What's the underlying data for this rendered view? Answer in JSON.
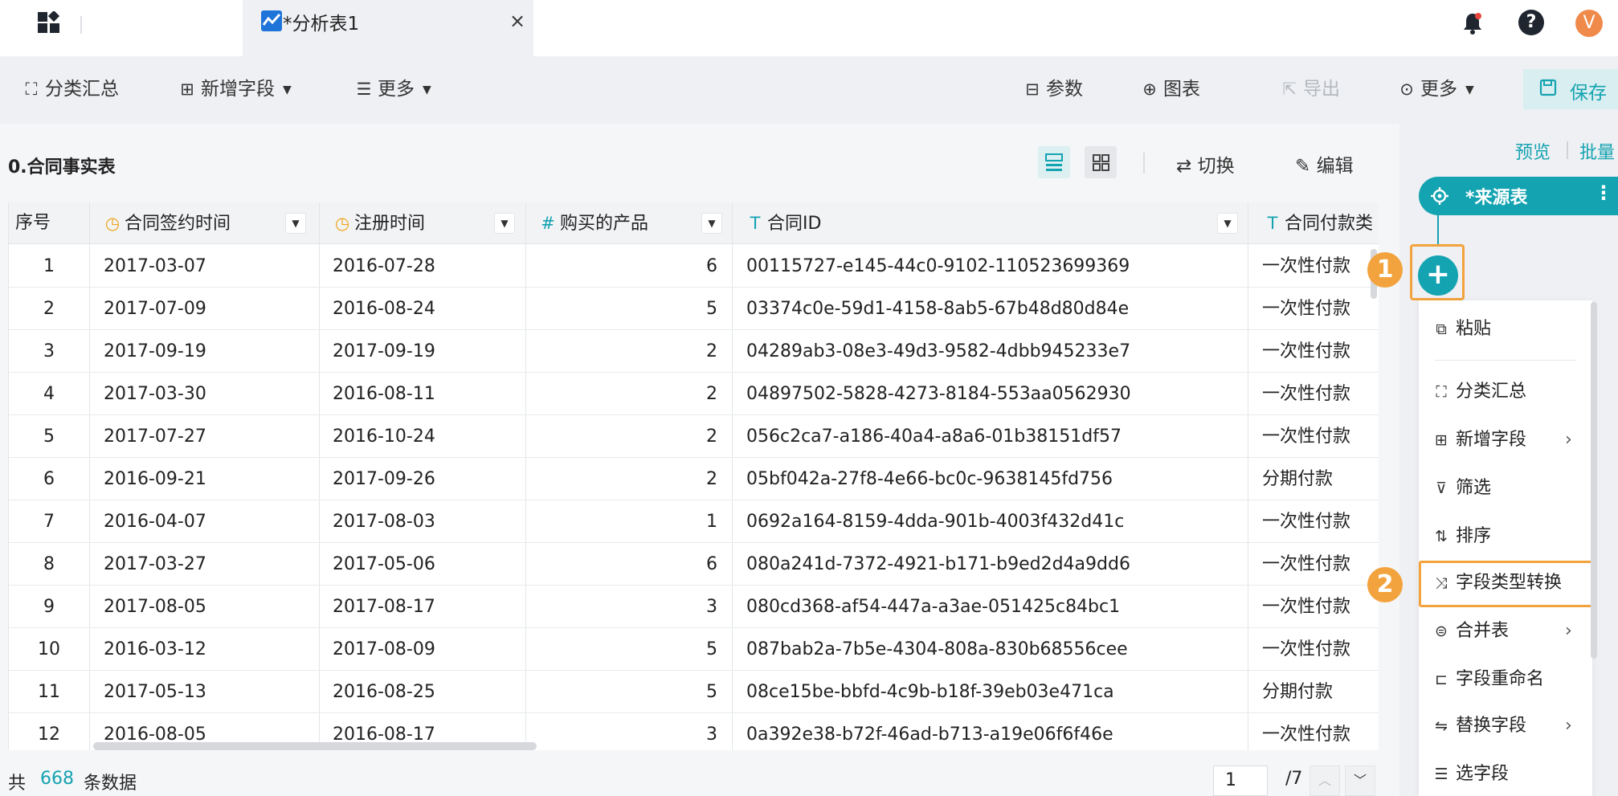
{
  "tab": {
    "title": "*分析表1",
    "close": "×"
  },
  "user": {
    "avatar_letter": "V",
    "help": "?"
  },
  "toolbar": {
    "group_summary": "分类汇总",
    "add_field": "新增字段",
    "more_left": "更多",
    "params": "参数",
    "chart": "图表",
    "export": "导出",
    "more_right": "更多",
    "save": "保存"
  },
  "table_title": "0.合同事实表",
  "table_actions": {
    "switch": "切换",
    "edit": "编辑"
  },
  "columns": [
    "序号",
    "合同签约时间",
    "注册时间",
    "购买的产品",
    "合同ID",
    "合同付款类"
  ],
  "rows": [
    [
      "1",
      "2017-03-07",
      "2016-07-28",
      "6",
      "00115727-e145-44c0-9102-110523699369",
      "一次性付款"
    ],
    [
      "2",
      "2017-07-09",
      "2016-08-24",
      "5",
      "03374c0e-59d1-4158-8ab5-67b48d80d84e",
      "一次性付款"
    ],
    [
      "3",
      "2017-09-19",
      "2017-09-19",
      "2",
      "04289ab3-08e3-49d3-9582-4dbb945233e7",
      "一次性付款"
    ],
    [
      "4",
      "2017-03-30",
      "2016-08-11",
      "2",
      "04897502-5828-4273-8184-553aa0562930",
      "一次性付款"
    ],
    [
      "5",
      "2017-07-27",
      "2016-10-24",
      "2",
      "056c2ca7-a186-40a4-a8a6-01b38151df57",
      "一次性付款"
    ],
    [
      "6",
      "2016-09-21",
      "2017-09-26",
      "2",
      "05bf042a-27f8-4e66-bc0c-9638145fd756",
      "分期付款"
    ],
    [
      "7",
      "2016-04-07",
      "2017-08-03",
      "1",
      "0692a164-8159-4dda-901b-4003f432d41c",
      "一次性付款"
    ],
    [
      "8",
      "2017-03-27",
      "2017-05-06",
      "6",
      "080a241d-7372-4921-b171-b9ed2d4a9dd6",
      "一次性付款"
    ],
    [
      "9",
      "2017-08-05",
      "2017-08-17",
      "3",
      "080cd368-af54-447a-a3ae-051425c84bc1",
      "一次性付款"
    ],
    [
      "10",
      "2016-03-12",
      "2017-08-09",
      "5",
      "087bab2a-7b5e-4304-808a-830b68556cee",
      "一次性付款"
    ],
    [
      "11",
      "2017-05-13",
      "2016-08-25",
      "5",
      "08ce15be-bbfd-4c9b-b18f-39eb03e471ca",
      "分期付款"
    ],
    [
      "12",
      "2016-08-05",
      "2016-08-17",
      "3",
      "0a392e38-b72f-46ad-b713-a19e06f6f46e",
      "一次性付款"
    ]
  ],
  "footer": {
    "prefix": "共",
    "count": "668",
    "suffix": "条数据",
    "page": "1",
    "total_pages": "/7"
  },
  "right_panel": {
    "preview": "预览",
    "batch": "批量",
    "node_title": "*来源表",
    "badge1": "1",
    "badge2": "2",
    "menu": [
      {
        "label": "粘贴",
        "icon": "paste-icon",
        "arrow": false
      },
      {
        "label": "分类汇总",
        "icon": "group-icon",
        "arrow": false
      },
      {
        "label": "新增字段",
        "icon": "add-field-icon",
        "arrow": true
      },
      {
        "label": "筛选",
        "icon": "filter-icon",
        "arrow": false
      },
      {
        "label": "排序",
        "icon": "sort-icon",
        "arrow": false
      },
      {
        "label": "字段类型转换",
        "icon": "shuffle-icon",
        "arrow": false
      },
      {
        "label": "合并表",
        "icon": "merge-icon",
        "arrow": true
      },
      {
        "label": "字段重命名",
        "icon": "rename-icon",
        "arrow": false
      },
      {
        "label": "替换字段",
        "icon": "replace-icon",
        "arrow": true
      },
      {
        "label": "选字段",
        "icon": "select-field-icon",
        "arrow": false
      }
    ]
  },
  "colors": {
    "accent": "#14a3b1",
    "highlight": "#f3a33d",
    "clock": "#f0a41a"
  }
}
